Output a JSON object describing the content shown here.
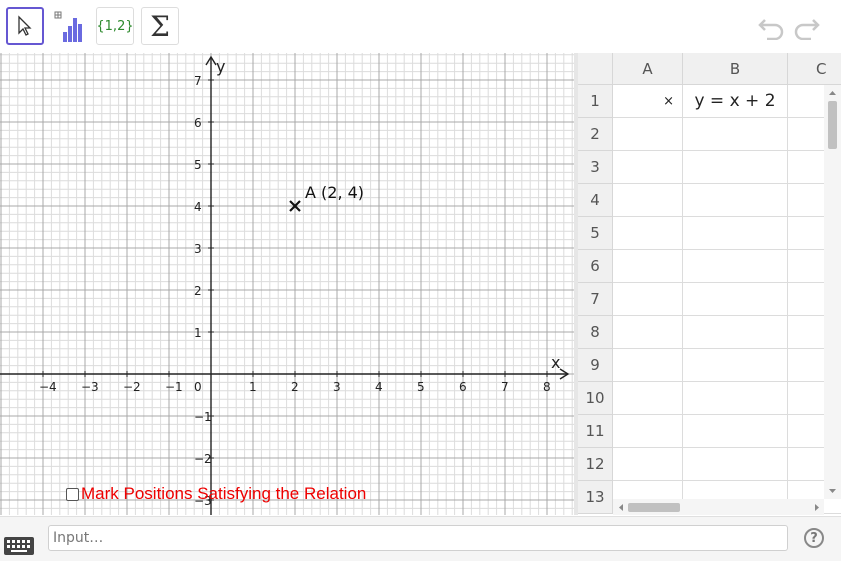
{
  "toolbar": {
    "tools": [
      {
        "name": "move-tool",
        "icon": "pointer-icon"
      },
      {
        "name": "one-variable-analysis-tool",
        "icon": "histogram-icon"
      },
      {
        "name": "create-list-tool",
        "label": "{1,2}"
      },
      {
        "name": "sum-tool",
        "label": "Σ"
      }
    ],
    "undo_icon": "undo-icon",
    "redo_icon": "redo-icon"
  },
  "graphics": {
    "x_axis_label": "x",
    "y_axis_label": "y",
    "x_ticks": [
      "−4",
      "−3",
      "−2",
      "−1",
      "0",
      "1",
      "2",
      "3",
      "4",
      "5",
      "6",
      "7",
      "8"
    ],
    "y_ticks": [
      "7",
      "6",
      "5",
      "4",
      "3",
      "2",
      "1",
      "−1",
      "−2",
      "−3"
    ],
    "point": {
      "label": "A (2, 4)",
      "x": 2,
      "y": 4
    },
    "checkbox": {
      "label": "Mark Positions Satisfying the Relation",
      "checked": false
    }
  },
  "spreadsheet": {
    "columns": [
      "A",
      "B",
      "C"
    ],
    "rows": [
      "1",
      "2",
      "3",
      "4",
      "5",
      "6",
      "7",
      "8",
      "9",
      "10",
      "11",
      "12",
      "13"
    ],
    "cells": {
      "A1": "×",
      "B1": "y = x + 2"
    }
  },
  "input_bar": {
    "placeholder": "Input…",
    "help": "?"
  },
  "colors": {
    "selected_tool_border": "#6557d2",
    "checkbox_label": "#e00000",
    "list_tool_text": "#2d8a2d"
  }
}
